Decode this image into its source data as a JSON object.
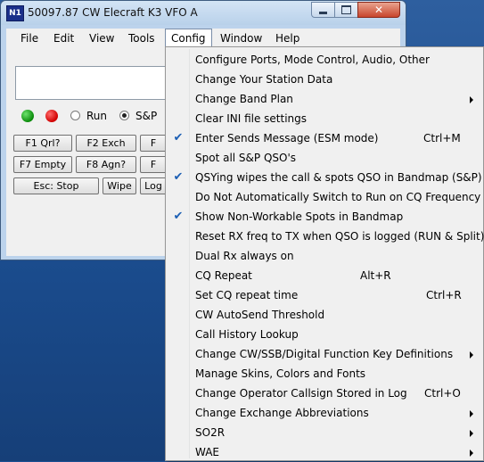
{
  "window": {
    "title": "50097.87 CW Elecraft K3 VFO A",
    "icon_text": "N1"
  },
  "menubar": {
    "items": [
      {
        "label": "File"
      },
      {
        "label": "Edit"
      },
      {
        "label": "View"
      },
      {
        "label": "Tools"
      },
      {
        "label": "Config",
        "active": true
      },
      {
        "label": "Window"
      },
      {
        "label": "Help"
      }
    ]
  },
  "mode": {
    "run_label": "Run",
    "sp_label": "S&P",
    "selected": "S&P"
  },
  "function_keys": {
    "row1": [
      "F1 Qrl?",
      "F2 Exch",
      "F"
    ],
    "row2": [
      "F7 Empty",
      "F8 Agn?",
      "F"
    ],
    "row3": [
      "Esc: Stop",
      "Wipe",
      "Log"
    ]
  },
  "config_menu": {
    "items": [
      {
        "label": "Configure Ports, Mode Control, Audio, Other",
        "checked": false,
        "shortcut": "",
        "submenu": false
      },
      {
        "label": "Change Your Station Data",
        "checked": false,
        "shortcut": "",
        "submenu": false
      },
      {
        "label": "Change Band Plan",
        "checked": false,
        "shortcut": "",
        "submenu": true
      },
      {
        "label": "Clear INI file settings",
        "checked": false,
        "shortcut": "",
        "submenu": false
      },
      {
        "label": "Enter Sends Message (ESM mode)",
        "checked": true,
        "shortcut": "Ctrl+M",
        "submenu": false
      },
      {
        "label": "Spot all S&P QSO's",
        "checked": false,
        "shortcut": "",
        "submenu": false
      },
      {
        "label": "QSYing wipes the call & spots QSO in Bandmap (S&P)",
        "checked": true,
        "shortcut": "",
        "submenu": false
      },
      {
        "label": "Do Not Automatically Switch to Run on CQ Frequency",
        "checked": false,
        "shortcut": "",
        "submenu": false
      },
      {
        "label": "Show Non-Workable Spots in Bandmap",
        "checked": true,
        "shortcut": "",
        "submenu": false
      },
      {
        "label": "Reset RX freq to TX when QSO is logged (RUN & Split)",
        "checked": false,
        "shortcut": "",
        "submenu": false
      },
      {
        "label": "Dual Rx always on",
        "checked": false,
        "shortcut": "",
        "submenu": false
      },
      {
        "label": "CQ Repeat",
        "checked": false,
        "shortcut": "Alt+R",
        "submenu": false
      },
      {
        "label": "Set CQ repeat time",
        "checked": false,
        "shortcut": "Ctrl+R",
        "submenu": false
      },
      {
        "label": "CW AutoSend Threshold",
        "checked": false,
        "shortcut": "",
        "submenu": false
      },
      {
        "label": "Call History Lookup",
        "checked": false,
        "shortcut": "",
        "submenu": false
      },
      {
        "label": "Change CW/SSB/Digital Function Key Definitions",
        "checked": false,
        "shortcut": "",
        "submenu": true
      },
      {
        "label": "Manage Skins, Colors and Fonts",
        "checked": false,
        "shortcut": "",
        "submenu": false
      },
      {
        "label": "Change Operator Callsign Stored in Log",
        "checked": false,
        "shortcut": "Ctrl+O",
        "submenu": false
      },
      {
        "label": "Change Exchange Abbreviations",
        "checked": false,
        "shortcut": "",
        "submenu": true
      },
      {
        "label": "SO2R",
        "checked": false,
        "shortcut": "",
        "submenu": true
      },
      {
        "label": "WAE",
        "checked": false,
        "shortcut": "",
        "submenu": true
      }
    ],
    "check_glyph": "✔"
  },
  "colors": {
    "desktop": "#1d4f92",
    "titlebar": "#bcd3ec",
    "led_green": "#0a8a0a",
    "led_red": "#d00000",
    "check": "#1c5fb4"
  }
}
